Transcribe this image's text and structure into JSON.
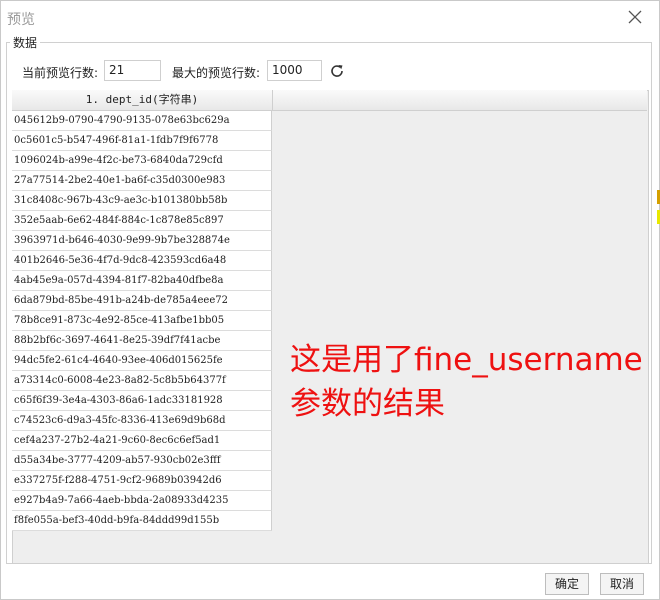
{
  "dialog": {
    "title": "预览"
  },
  "group": {
    "legend": "数据"
  },
  "controls": {
    "current_rows_label": "当前预览行数:",
    "current_rows_value": "21",
    "max_rows_label": "最大的预览行数:",
    "max_rows_value": "1000"
  },
  "table": {
    "column_header": "1. dept_id(字符串)",
    "rows": [
      "045612b9-0790-4790-9135-078e63bc629a",
      "0c5601c5-b547-496f-81a1-1fdb7f9f6778",
      "1096024b-a99e-4f2c-be73-6840da729cfd",
      "27a77514-2be2-40e1-ba6f-c35d0300e983",
      "31c8408c-967b-43c9-ae3c-b101380bb58b",
      "352e5aab-6e62-484f-884c-1c878e85c897",
      "3963971d-b646-4030-9e99-9b7be328874e",
      "401b2646-5e36-4f7d-9dc8-423593cd6a48",
      "4ab45e9a-057d-4394-81f7-82ba40dfbe8a",
      "6da879bd-85be-491b-a24b-de785a4eee72",
      "78b8ce91-873c-4e92-85ce-413afbe1bb05",
      "88b2bf6c-3697-4641-8e25-39df7f41acbe",
      "94dc5fe2-61c4-4640-93ee-406d015625fe",
      "a73314c0-6008-4e23-8a82-5c8b5b64377f",
      "c65f6f39-3e4a-4303-86a6-1adc33181928",
      "c74523c6-d9a3-45fc-8336-413e69d9b68d",
      "cef4a237-27b2-4a21-9c60-8ec6c6ef5ad1",
      "d55a34be-3777-4209-ab57-930cb02e3fff",
      "e337275f-f288-4751-9cf2-9689b03942d6",
      "e927b4a9-7a66-4aeb-bbda-2a08933d4235",
      "f8fe055a-bef3-40dd-b9fa-84ddd99d155b"
    ]
  },
  "annotation": {
    "line1": "这是用了fine_username",
    "line2": "参数的结果",
    "color": "#ee1111"
  },
  "buttons": {
    "ok": "确定",
    "cancel": "取消"
  }
}
